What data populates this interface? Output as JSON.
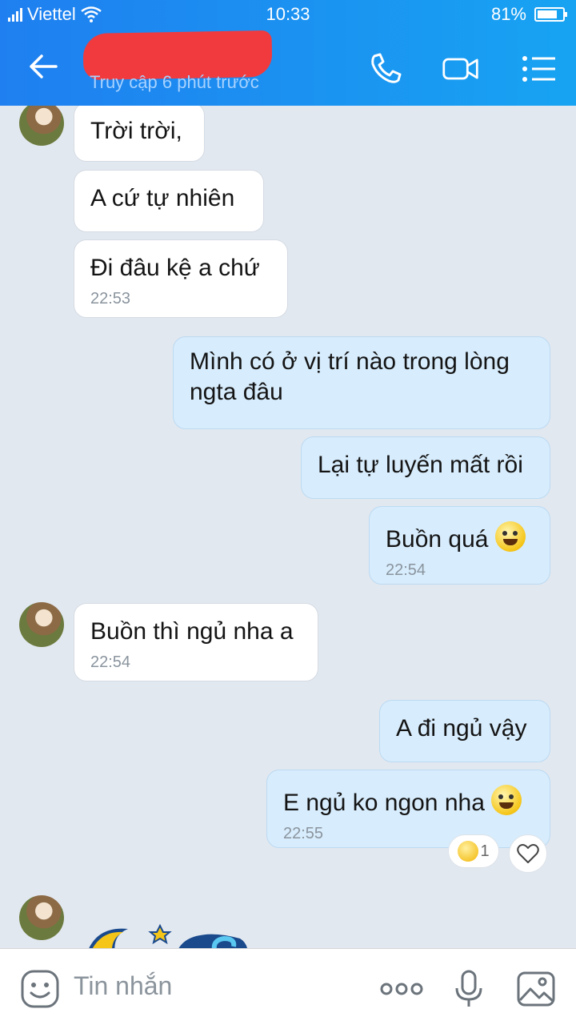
{
  "status_bar": {
    "carrier": "Viettel",
    "time": "10:33",
    "battery": "81%",
    "battery_level": 0.81
  },
  "header": {
    "subtitle": "Truy cập 6 phút trước",
    "icons": [
      "back-arrow-icon",
      "phone-icon",
      "video-call-icon",
      "menu-list-icon"
    ]
  },
  "messages": [
    {
      "side": "in",
      "text": "Trời trời,",
      "time": ""
    },
    {
      "side": "in",
      "text": "A cứ tự nhiên",
      "time": ""
    },
    {
      "side": "in",
      "text": "Đi đâu kệ a chứ",
      "time": "22:53"
    },
    {
      "side": "out",
      "text": "Mình có ở vị trí nào trong lòng ngta đâu",
      "time": ""
    },
    {
      "side": "out",
      "text": "Lại tự luyến mất rồi",
      "time": ""
    },
    {
      "side": "out",
      "text": "Buồn quá",
      "time": "22:54",
      "emoji": "laughing-tears-emoji"
    },
    {
      "side": "in",
      "text": "Buồn thì ngủ nha a",
      "time": "22:54"
    },
    {
      "side": "out",
      "text": "A đi ngủ vậy",
      "time": ""
    },
    {
      "side": "out",
      "text": "E ngủ ko ngon nha",
      "time": "22:55",
      "emoji": "smiling-face-emoji"
    }
  ],
  "reaction": {
    "count": "1"
  },
  "input": {
    "placeholder": "Tin nhắn"
  }
}
